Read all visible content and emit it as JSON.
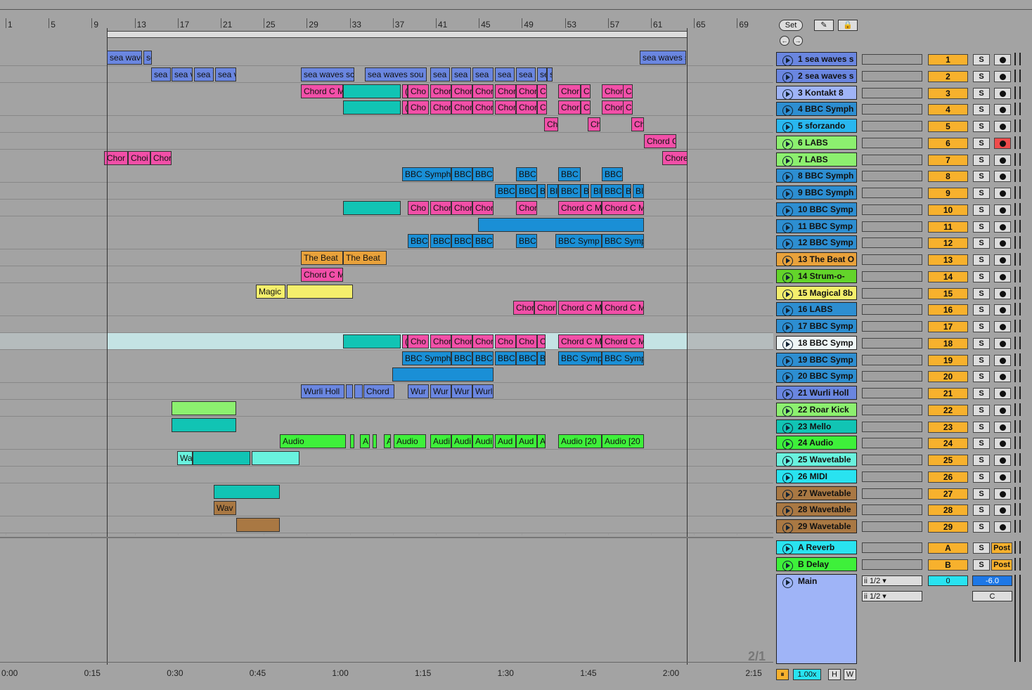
{
  "ruler": {
    "bars": [
      "1",
      "5",
      "9",
      "13",
      "17",
      "21",
      "25",
      "29",
      "33",
      "37",
      "41",
      "45",
      "49",
      "53",
      "57",
      "61",
      "65",
      "69"
    ]
  },
  "time_labels": [
    "0:00",
    "0:15",
    "0:30",
    "0:45",
    "1:00",
    "1:15",
    "1:30",
    "1:45",
    "2:00",
    "2:15"
  ],
  "controls": {
    "set_label": "Set",
    "zoom_label": "1.00x",
    "h_label": "H",
    "w_label": "W",
    "page_label": "2/1"
  },
  "colors": {
    "blue1": "#6a86e0",
    "pink": "#f24fa8",
    "teal": "#11c4b4",
    "cyan": "#1a8fd6",
    "green": "#63ef2a",
    "yellow": "#f4ef6c",
    "orange": "#e9a23b",
    "brown": "#a97843",
    "mint": "#69f2de",
    "lightgreen": "#8cf06f",
    "lightblue": "#9fb4f7",
    "lightcyan": "#29e3f0",
    "midblue": "#2d8ed1"
  },
  "tracks": [
    {
      "name": "1 sea waves s",
      "num": "1",
      "color": "#6a86e0",
      "arm": "full"
    },
    {
      "name": "2 sea waves s",
      "num": "2",
      "color": "#6a86e0",
      "arm": "full"
    },
    {
      "name": "3 Kontakt 8",
      "num": "3",
      "color": "#9fb4f7",
      "arm": "half"
    },
    {
      "name": "4 BBC Symph",
      "num": "4",
      "color": "#2d8ed1",
      "arm": "half"
    },
    {
      "name": "5 sforzando",
      "num": "5",
      "color": "#29b7ef",
      "arm": "half"
    },
    {
      "name": "6 LABS",
      "num": "6",
      "color": "#8cf06f",
      "arm": "on"
    },
    {
      "name": "7 LABS",
      "num": "7",
      "color": "#8cf06f",
      "arm": "half"
    },
    {
      "name": "8 BBC Symph",
      "num": "8",
      "color": "#2d8ed1",
      "arm": "half"
    },
    {
      "name": "9 BBC Symph",
      "num": "9",
      "color": "#2d8ed1",
      "arm": "half"
    },
    {
      "name": "10 BBC Symp",
      "num": "10",
      "color": "#2d8ed1",
      "arm": "half"
    },
    {
      "name": "11 BBC Symp",
      "num": "11",
      "color": "#2d8ed1",
      "arm": "half"
    },
    {
      "name": "12 BBC Symp",
      "num": "12",
      "color": "#2d8ed1",
      "arm": "half"
    },
    {
      "name": "13 The Beat O",
      "num": "13",
      "color": "#e9a23b",
      "arm": "half"
    },
    {
      "name": "14 Strum-o-",
      "num": "14",
      "color": "#63d42a",
      "arm": "half"
    },
    {
      "name": "15 Magical 8b",
      "num": "15",
      "color": "#f4ef6c",
      "arm": "half"
    },
    {
      "name": "16 LABS",
      "num": "16",
      "color": "#2d8ed1",
      "arm": "half"
    },
    {
      "name": "17 BBC Symp",
      "num": "17",
      "color": "#2d8ed1",
      "arm": "half"
    },
    {
      "name": "18 BBC Symp",
      "num": "18",
      "color": "#eef6f6",
      "arm": "half"
    },
    {
      "name": "19 BBC Symp",
      "num": "19",
      "color": "#2d8ed1",
      "arm": "half"
    },
    {
      "name": "20 BBC Symp",
      "num": "20",
      "color": "#2d8ed1",
      "arm": "half"
    },
    {
      "name": "21 Wurli Holl",
      "num": "21",
      "color": "#6a86e0",
      "arm": "half"
    },
    {
      "name": "22 Roar Kick",
      "num": "22",
      "color": "#8cf06f",
      "arm": "full"
    },
    {
      "name": "23 Mello",
      "num": "23",
      "color": "#11c4b4",
      "arm": "half"
    },
    {
      "name": "24 Audio",
      "num": "24",
      "color": "#3ef03a",
      "arm": "full"
    },
    {
      "name": "25 Wavetable",
      "num": "25",
      "color": "#69f2de",
      "arm": "half"
    },
    {
      "name": "26 MIDI",
      "num": "26",
      "color": "#29e3f0",
      "arm": "half"
    },
    {
      "name": "27 Wavetable",
      "num": "27",
      "color": "#a97843",
      "arm": "half"
    },
    {
      "name": "28 Wavetable",
      "num": "28",
      "color": "#a97843",
      "arm": "half"
    },
    {
      "name": "29 Wavetable",
      "num": "29",
      "color": "#a97843",
      "arm": "half"
    }
  ],
  "returns": [
    {
      "name": "A Reverb",
      "num": "A",
      "color": "#29e3f0",
      "post": "Post"
    },
    {
      "name": "B Delay",
      "num": "B",
      "color": "#3ef03a",
      "post": "Post"
    }
  ],
  "main": {
    "name": "Main",
    "io1": "ii 1/2",
    "io2": "ii 1/2",
    "vol": "0",
    "gain": "-6.0",
    "pan": "C",
    "color": "#9fb4f7"
  },
  "clips": [
    [
      [
        "sea wave",
        152,
        50,
        "#6a86e0"
      ],
      [
        "se",
        204,
        12,
        "#6a86e0"
      ],
      [
        "sea waves s",
        910,
        66,
        "#6a86e0"
      ]
    ],
    [
      [
        "sea v",
        215,
        28,
        "#6a86e0"
      ],
      [
        "sea v",
        244,
        30,
        "#6a86e0"
      ],
      [
        "sea v",
        276,
        28,
        "#6a86e0"
      ],
      [
        "sea v",
        306,
        30,
        "#6a86e0"
      ],
      [
        "sea waves sc",
        428,
        76,
        "#6a86e0"
      ],
      [
        "sea waves sou",
        519,
        88,
        "#6a86e0"
      ],
      [
        "sea",
        612,
        28,
        "#6a86e0"
      ],
      [
        "sea",
        642,
        28,
        "#6a86e0"
      ],
      [
        "sea",
        672,
        30,
        "#6a86e0"
      ],
      [
        "sea",
        704,
        28,
        "#6a86e0"
      ],
      [
        "sea",
        734,
        28,
        "#6a86e0"
      ],
      [
        "se",
        764,
        14,
        "#6a86e0"
      ],
      [
        "s",
        778,
        8,
        "#6a86e0"
      ]
    ],
    [
      [
        "Chord C M",
        428,
        60,
        "#f24fa8"
      ],
      [
        "",
        488,
        82,
        "#11c4b4"
      ],
      [
        "(",
        572,
        8,
        "#f24fa8"
      ],
      [
        "Cho",
        580,
        30,
        "#f24fa8"
      ],
      [
        "Chor",
        612,
        30,
        "#f24fa8"
      ],
      [
        "Chor",
        642,
        30,
        "#f24fa8"
      ],
      [
        "Chor",
        672,
        30,
        "#f24fa8"
      ],
      [
        "Chor",
        704,
        30,
        "#f24fa8"
      ],
      [
        "Chor",
        734,
        30,
        "#f24fa8"
      ],
      [
        "Cl",
        764,
        14,
        "#f24fa8"
      ],
      [
        "Chor",
        794,
        32,
        "#f24fa8"
      ],
      [
        "Cl",
        826,
        14,
        "#f24fa8"
      ],
      [
        "Chor",
        856,
        32,
        "#f24fa8"
      ],
      [
        "Ch",
        886,
        14,
        "#f24fa8"
      ]
    ],
    [
      [
        "",
        488,
        82,
        "#11c4b4"
      ],
      [
        "(",
        572,
        8,
        "#f24fa8"
      ],
      [
        "Cho",
        580,
        30,
        "#f24fa8"
      ],
      [
        "Chor",
        612,
        30,
        "#f24fa8"
      ],
      [
        "Chor",
        642,
        30,
        "#f24fa8"
      ],
      [
        "Chor",
        672,
        30,
        "#f24fa8"
      ],
      [
        "Chor",
        704,
        30,
        "#f24fa8"
      ],
      [
        "Chor",
        734,
        30,
        "#f24fa8"
      ],
      [
        "Cl",
        764,
        14,
        "#f24fa8"
      ],
      [
        "Chor",
        794,
        32,
        "#f24fa8"
      ],
      [
        "Cl",
        826,
        14,
        "#f24fa8"
      ],
      [
        "Chor",
        856,
        32,
        "#f24fa8"
      ],
      [
        "Ch",
        886,
        14,
        "#f24fa8"
      ]
    ],
    [
      [
        "Ch",
        774,
        20,
        "#f24fa8"
      ],
      [
        "Ch",
        836,
        18,
        "#f24fa8"
      ],
      [
        "Ch",
        898,
        18,
        "#f24fa8"
      ]
    ],
    [
      [
        "Chord C",
        916,
        46,
        "#f24fa8"
      ]
    ],
    [
      [
        "Chor",
        148,
        34,
        "#f24fa8"
      ],
      [
        "Choi",
        182,
        32,
        "#f24fa8"
      ],
      [
        "Chor",
        214,
        30,
        "#f24fa8"
      ],
      [
        "Chore",
        942,
        36,
        "#f24fa8"
      ]
    ],
    [
      [
        "BBC Symph",
        572,
        70,
        "#1a8fd6"
      ],
      [
        "BBC",
        642,
        30,
        "#1a8fd6"
      ],
      [
        "BBC",
        672,
        30,
        "#1a8fd6"
      ],
      [
        "BBC",
        734,
        30,
        "#1a8fd6"
      ],
      [
        "BBC",
        794,
        32,
        "#1a8fd6"
      ],
      [
        "BBC",
        856,
        30,
        "#1a8fd6"
      ]
    ],
    [
      [
        "BBC",
        704,
        30,
        "#1a8fd6"
      ],
      [
        "BBC",
        734,
        30,
        "#1a8fd6"
      ],
      [
        "B",
        764,
        12,
        "#1a8fd6"
      ],
      [
        "BI",
        778,
        16,
        "#1a8fd6"
      ],
      [
        "BBC",
        794,
        32,
        "#1a8fd6"
      ],
      [
        "B",
        826,
        12,
        "#1a8fd6"
      ],
      [
        "BI",
        840,
        16,
        "#1a8fd6"
      ],
      [
        "BBC",
        856,
        30,
        "#1a8fd6"
      ],
      [
        "B",
        886,
        12,
        "#1a8fd6"
      ],
      [
        "BI",
        900,
        16,
        "#1a8fd6"
      ]
    ],
    [
      [
        "",
        488,
        82,
        "#11c4b4"
      ],
      [
        "Cho",
        580,
        30,
        "#f24fa8"
      ],
      [
        "Chor",
        612,
        30,
        "#f24fa8"
      ],
      [
        "Chor",
        642,
        30,
        "#f24fa8"
      ],
      [
        "Chor",
        672,
        30,
        "#f24fa8"
      ],
      [
        "Chor",
        734,
        30,
        "#f24fa8"
      ],
      [
        "Chord C M",
        794,
        62,
        "#f24fa8"
      ],
      [
        "Chord C M",
        856,
        60,
        "#f24fa8"
      ]
    ],
    [
      [
        "",
        680,
        236,
        "#1a8fd6"
      ]
    ],
    [
      [
        "BBC",
        580,
        30,
        "#1a8fd6"
      ],
      [
        "BBC",
        612,
        30,
        "#1a8fd6"
      ],
      [
        "BBC",
        642,
        30,
        "#1a8fd6"
      ],
      [
        "BBC",
        672,
        30,
        "#1a8fd6"
      ],
      [
        "BBC",
        734,
        30,
        "#1a8fd6"
      ],
      [
        "BBC Symp",
        790,
        66,
        "#1a8fd6"
      ],
      [
        "BBC Symp",
        856,
        60,
        "#1a8fd6"
      ]
    ],
    [
      [
        "The Beat",
        428,
        60,
        "#e9a23b"
      ],
      [
        "The Beat",
        488,
        62,
        "#e9a23b"
      ]
    ],
    [
      [
        "Chord C M",
        428,
        60,
        "#f24fa8"
      ]
    ],
    [
      [
        "Magic",
        364,
        42,
        "#f4ef6c"
      ],
      [
        "",
        408,
        94,
        "#f4ef6c"
      ]
    ],
    [
      [
        "Chor",
        730,
        30,
        "#f24fa8"
      ],
      [
        "Chor",
        760,
        32,
        "#f24fa8"
      ],
      [
        "Chord C M",
        794,
        62,
        "#f24fa8"
      ],
      [
        "Chord C M",
        856,
        60,
        "#f24fa8"
      ]
    ],
    [],
    [
      [
        "",
        488,
        82,
        "#11c4b4"
      ],
      [
        "(",
        572,
        8,
        "#f24fa8"
      ],
      [
        "Cho",
        580,
        30,
        "#f24fa8"
      ],
      [
        "Chor",
        612,
        30,
        "#f24fa8"
      ],
      [
        "Chor",
        642,
        30,
        "#f24fa8"
      ],
      [
        "Chor",
        672,
        30,
        "#f24fa8"
      ],
      [
        "Cho",
        704,
        30,
        "#f24fa8"
      ],
      [
        "Cho",
        734,
        30,
        "#f24fa8"
      ],
      [
        "C",
        764,
        12,
        "#f24fa8"
      ],
      [
        "Chord C M",
        794,
        62,
        "#f24fa8"
      ],
      [
        "Chord C M",
        856,
        60,
        "#f24fa8"
      ]
    ],
    [
      [
        "BBC Symph",
        572,
        70,
        "#1a8fd6"
      ],
      [
        "BBC",
        642,
        30,
        "#1a8fd6"
      ],
      [
        "BBC",
        672,
        30,
        "#1a8fd6"
      ],
      [
        "BBC",
        704,
        30,
        "#1a8fd6"
      ],
      [
        "BBC",
        734,
        30,
        "#1a8fd6"
      ],
      [
        "B",
        764,
        12,
        "#1a8fd6"
      ],
      [
        "BBC Symp",
        794,
        62,
        "#1a8fd6"
      ],
      [
        "BBC Symp",
        856,
        60,
        "#1a8fd6"
      ]
    ],
    [
      [
        "",
        558,
        144,
        "#1a8fd6"
      ]
    ],
    [
      [
        "Wurli Holl",
        428,
        62,
        "#6a86e0"
      ],
      [
        "",
        492,
        10,
        "#6a86e0"
      ],
      [
        "",
        504,
        12,
        "#6a86e0"
      ],
      [
        "Chord",
        517,
        44,
        "#6a86e0"
      ],
      [
        "Wur",
        580,
        30,
        "#6a86e0"
      ],
      [
        "Wur",
        612,
        30,
        "#6a86e0"
      ],
      [
        "Wur",
        642,
        30,
        "#6a86e0"
      ],
      [
        "Wurl",
        672,
        30,
        "#6a86e0"
      ]
    ],
    [
      [
        "",
        244,
        92,
        "#8cf06f"
      ]
    ],
    [
      [
        "",
        244,
        92,
        "#11c4b4"
      ]
    ],
    [
      [
        "Audio",
        398,
        94,
        "#3ef03a"
      ],
      [
        "",
        498,
        6,
        "#3ef03a"
      ],
      [
        "A",
        512,
        14,
        "#3ef03a"
      ],
      [
        "",
        530,
        6,
        "#3ef03a"
      ],
      [
        "A",
        546,
        10,
        "#3ef03a"
      ],
      [
        "Audio",
        560,
        46,
        "#3ef03a"
      ],
      [
        "Audi",
        612,
        30,
        "#3ef03a"
      ],
      [
        "Audi",
        642,
        30,
        "#3ef03a"
      ],
      [
        "Audi",
        672,
        30,
        "#3ef03a"
      ],
      [
        "Aud",
        704,
        30,
        "#3ef03a"
      ],
      [
        "Aud",
        734,
        30,
        "#3ef03a"
      ],
      [
        "A",
        764,
        12,
        "#3ef03a"
      ],
      [
        "Audio [20",
        794,
        62,
        "#3ef03a"
      ],
      [
        "Audio [20",
        856,
        60,
        "#3ef03a"
      ]
    ],
    [
      [
        "Wa",
        252,
        22,
        "#69f2de"
      ],
      [
        "",
        274,
        82,
        "#11c4b4"
      ],
      [
        "",
        358,
        68,
        "#69f2de"
      ]
    ],
    [],
    [
      [
        "",
        304,
        94,
        "#11c4b4"
      ]
    ],
    [
      [
        "Wav",
        304,
        32,
        "#a97843"
      ]
    ],
    [
      [
        "",
        336,
        62,
        "#a97843"
      ]
    ]
  ]
}
